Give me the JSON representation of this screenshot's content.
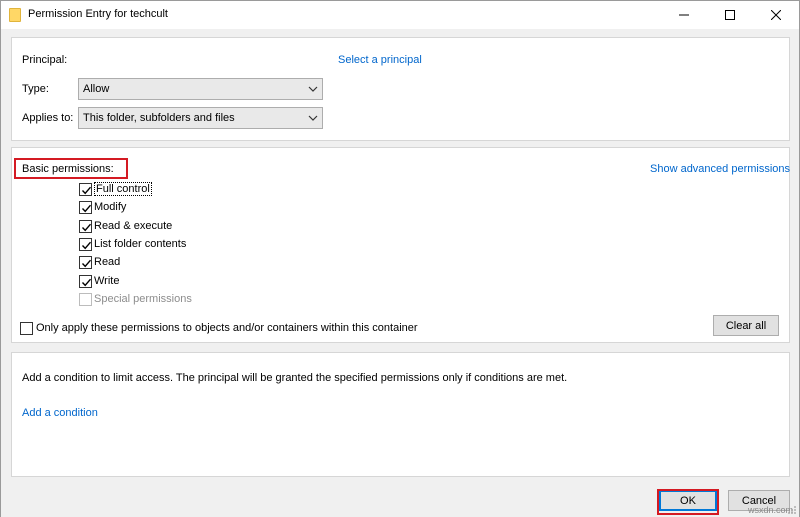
{
  "window": {
    "title": "Permission Entry for techcult",
    "controls": {
      "minimize": "minimize-icon",
      "maximize": "maximize-icon",
      "close": "close-icon"
    }
  },
  "principal_section": {
    "principal_label": "Principal:",
    "select_principal_link": "Select a principal",
    "type_label": "Type:",
    "type_value": "Allow",
    "applies_label": "Applies to:",
    "applies_value": "This folder, subfolders and files"
  },
  "permissions_section": {
    "heading": "Basic permissions:",
    "advanced_link": "Show advanced permissions",
    "items": [
      {
        "label": "Full control",
        "checked": true,
        "enabled": true
      },
      {
        "label": "Modify",
        "checked": true,
        "enabled": true
      },
      {
        "label": "Read & execute",
        "checked": true,
        "enabled": true
      },
      {
        "label": "List folder contents",
        "checked": true,
        "enabled": true
      },
      {
        "label": "Read",
        "checked": true,
        "enabled": true
      },
      {
        "label": "Write",
        "checked": true,
        "enabled": true
      },
      {
        "label": "Special permissions",
        "checked": false,
        "enabled": false
      }
    ],
    "only_apply_label": "Only apply these permissions to objects and/or containers within this container",
    "only_apply_checked": false,
    "clear_all_label": "Clear all"
  },
  "condition_section": {
    "description": "Add a condition to limit access. The principal will be granted the specified permissions only if conditions are met.",
    "add_condition_link": "Add a condition"
  },
  "footer": {
    "ok_label": "OK",
    "cancel_label": "Cancel"
  },
  "watermark": "wsxdn.com",
  "colors": {
    "accent": "#0078d7",
    "link": "#0066cc",
    "highlight_box": "#d41a23",
    "window_bg": "#f0f0f0"
  }
}
